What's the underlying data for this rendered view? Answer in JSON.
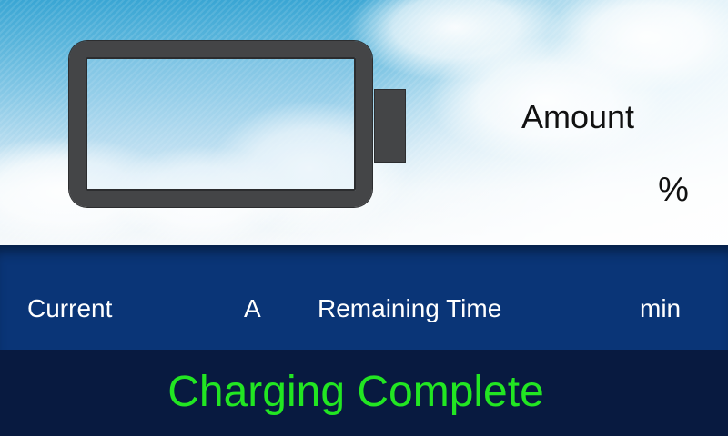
{
  "battery": {
    "amount_label": "Amount",
    "percent_unit": "%"
  },
  "info": {
    "current_label": "Current",
    "current_unit": "A",
    "remaining_label": "Remaining Time",
    "remaining_unit": "min"
  },
  "status": {
    "message": "Charging Complete"
  },
  "colors": {
    "info_bar": "#0a3577",
    "status_bar": "#081a40",
    "status_text": "#22e622",
    "battery_frame": "#444547"
  },
  "icons": [
    "battery-icon"
  ]
}
